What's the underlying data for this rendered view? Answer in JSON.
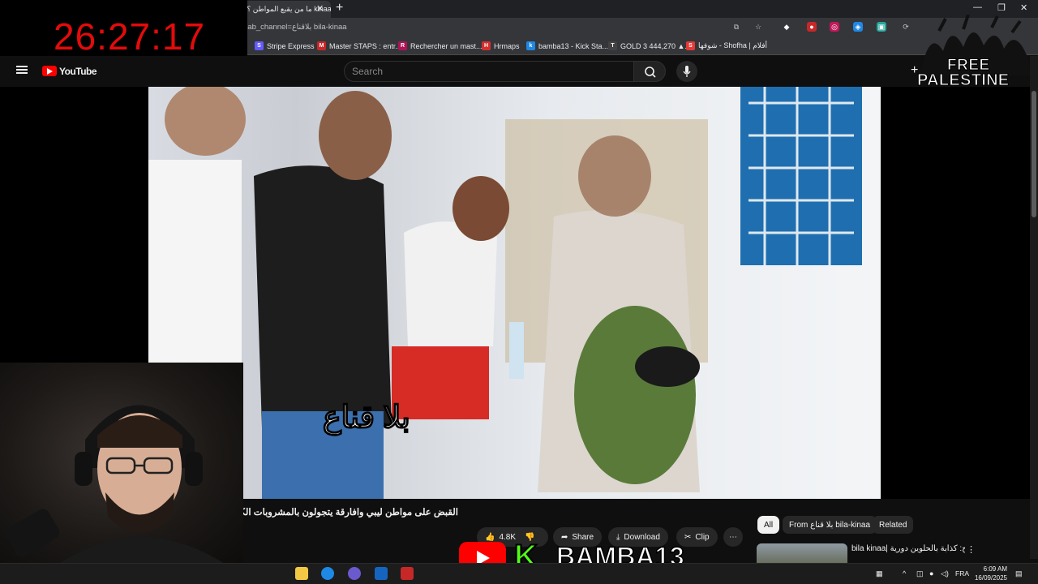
{
  "browser": {
    "tab_title": "!ما من يقبع المواطن ؟ kinaa",
    "url": "?ab_channel=بلاقناع bila-kinaa",
    "bookmarks": [
      {
        "label": "Stripe Express",
        "icon_color": "#635bff",
        "icon_glyph": "S"
      },
      {
        "label": "Master STAPS : entr...",
        "icon_color": "#c62828",
        "icon_glyph": "M"
      },
      {
        "label": "Rechercher un mast...",
        "icon_color": "#ad1457",
        "icon_glyph": "R"
      },
      {
        "label": "Hrmaps",
        "icon_color": "#d32f2f",
        "icon_glyph": "H"
      },
      {
        "label": "bamba13 - Kick Sta...",
        "icon_color": "#1e88e5",
        "icon_glyph": "k"
      },
      {
        "label": "GOLD 3 444,270 ▲...",
        "icon_color": "#424242",
        "icon_glyph": "T"
      },
      {
        "label": "شوفها - Shofha | أفلام",
        "icon_color": "#e53935",
        "icon_glyph": "S"
      }
    ]
  },
  "overlay": {
    "timer": "26:27:17",
    "free": "FREE",
    "palestine": "PALESTINE",
    "streamer_name": "BAMBA13",
    "kick_letter": "K"
  },
  "youtube": {
    "logo_text": "YouTube",
    "search_placeholder": "Search",
    "video_caption": "بلا قناع",
    "video_title": "القبض على مواطن ليبي وافارقة يتجولون بالمشروبات الكحولية",
    "like_count": "4.8K",
    "actions": {
      "share": "Share",
      "download": "Download",
      "clip": "Clip"
    },
    "filter_chips": [
      "All",
      "From بلا قناع bila-kinaa",
      "Related"
    ],
    "related": {
      "title": "bila kinaa| صالح: كذابة بالحلوين دورية"
    }
  },
  "taskbar": {
    "language": "FRA",
    "time": "6:09 AM",
    "date": "16/09/2025"
  }
}
